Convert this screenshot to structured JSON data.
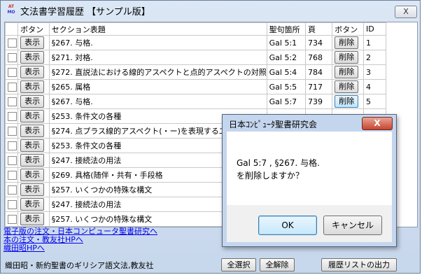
{
  "window": {
    "title": "文法書学習履歴 【サンプル版】",
    "close_label": "X",
    "icon_letters": [
      "AT",
      "MO"
    ]
  },
  "grid": {
    "headers": [
      "ボタン",
      "セクション表題",
      "聖句箇所",
      "頁",
      "ボタン",
      "ID"
    ],
    "rows": [
      {
        "show": "表示",
        "section": "§267. 与格.",
        "verse": "Gal 5:1",
        "page": "734",
        "del": "削除",
        "id": "1"
      },
      {
        "show": "表示",
        "section": "§271. 対格.",
        "verse": "Gal 5:2",
        "page": "768",
        "del": "削除",
        "id": "2"
      },
      {
        "show": "表示",
        "section": "§272. 直説法における線的アスペクトと点的アスペクトの対照",
        "verse": "Gal 5:4",
        "page": "784",
        "del": "削除",
        "id": "3"
      },
      {
        "show": "表示",
        "section": "§265. 属格",
        "verse": "Gal 5:5",
        "page": "717",
        "del": "削除",
        "id": "4"
      },
      {
        "show": "表示",
        "section": "§267. 与格.",
        "verse": "Gal 5:7",
        "page": "739",
        "del": "削除",
        "id": "5"
      },
      {
        "show": "表示",
        "section": "§253. 条件文の各種",
        "verse": "",
        "page": "",
        "del": "",
        "id": ""
      },
      {
        "show": "表示",
        "section": "§274. 点プラス線的アスペクト(・ー)を表現する二つの",
        "verse": "",
        "page": "",
        "del": "",
        "id": ""
      },
      {
        "show": "表示",
        "section": "§253. 条件文の各種",
        "verse": "",
        "page": "",
        "del": "",
        "id": ""
      },
      {
        "show": "表示",
        "section": "§247. 接続法の用法",
        "verse": "",
        "page": "",
        "del": "",
        "id": ""
      },
      {
        "show": "表示",
        "section": "§269. 具格(随伴・共有・手段格",
        "verse": "",
        "page": "",
        "del": "",
        "id": ""
      },
      {
        "show": "表示",
        "section": "§257. いくつかの特殊な構文",
        "verse": "",
        "page": "",
        "del": "",
        "id": ""
      },
      {
        "show": "表示",
        "section": "§247. 接続法の用法",
        "verse": "",
        "page": "",
        "del": "",
        "id": ""
      },
      {
        "show": "表示",
        "section": "§257. いくつかの特殊な構文",
        "verse": "",
        "page": "",
        "del": "",
        "id": ""
      }
    ]
  },
  "links": [
    "電子版の注文・日本コンピュータ聖書研究へ",
    "本の注文・教友社HPへ",
    "織田昭HPへ"
  ],
  "status": {
    "text": "織田昭・新約聖書のギリシア語文法,教友社",
    "select_all": "全選択",
    "deselect_all": "全解除",
    "export": "履歴リストの出力"
  },
  "dialog": {
    "title": "日本ｺﾝﾋﾟｭｰﾀ聖書研究会",
    "close_label": "X",
    "message_line1": "Gal 5:7 , §267.  与格.",
    "message_line2": "を削除しますか？",
    "ok": "OK",
    "cancel": "キャンセル"
  }
}
